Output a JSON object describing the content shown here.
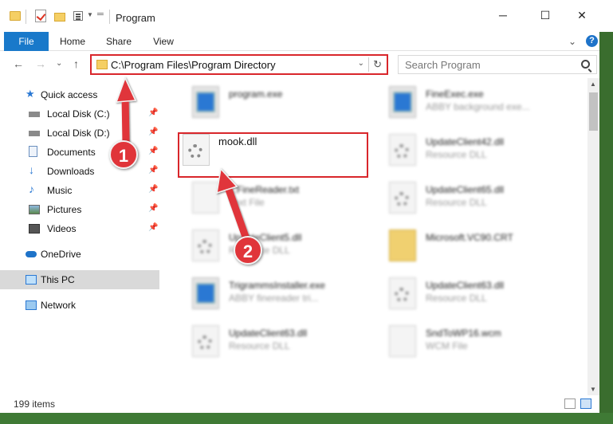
{
  "titlebar": {
    "title": "Program",
    "minimize": "─",
    "maximize": "☐",
    "close": "✕"
  },
  "ribbon": {
    "tabs": [
      "File",
      "Home",
      "Share",
      "View"
    ],
    "help": "?"
  },
  "nav": {
    "back": "←",
    "forward": "→",
    "dropdown": "⌄",
    "up": "↑",
    "address": "C:\\Program Files\\Program Directory",
    "address_dropdown": "⌄",
    "refresh": "↻",
    "search_placeholder": "Search Program"
  },
  "sidebar": {
    "quick_access": "Quick access",
    "pinned": [
      {
        "label": "Local Disk (C:)",
        "icon": "drive-icon"
      },
      {
        "label": "Local Disk (D:)",
        "icon": "drive-icon"
      },
      {
        "label": "Documents",
        "icon": "documents-icon"
      },
      {
        "label": "Downloads",
        "icon": "downloads-icon"
      },
      {
        "label": "Music",
        "icon": "music-icon"
      },
      {
        "label": "Pictures",
        "icon": "pictures-icon"
      },
      {
        "label": "Videos",
        "icon": "videos-icon"
      }
    ],
    "onedrive": "OneDrive",
    "thispc": "This PC",
    "network": "Network",
    "pin_glyph": "📌"
  },
  "files": [
    {
      "name": "program.exe",
      "sub": "",
      "type": "exe"
    },
    {
      "name": "FineExec.exe",
      "sub": "ABBY background exe...",
      "type": "exe"
    },
    {
      "name": "mook.dll",
      "sub": "",
      "type": "dll"
    },
    {
      "name": "UpdateClient42.dll",
      "sub": "Resource DLL",
      "type": "dll"
    },
    {
      "name": "...FineReader.txt",
      "sub": "Text File",
      "type": "txt"
    },
    {
      "name": "UpdateClient65.dll",
      "sub": "Resource DLL",
      "type": "dll"
    },
    {
      "name": "UpdateClient5.dll",
      "sub": "Resource DLL",
      "type": "dll"
    },
    {
      "name": "Microsoft.VC90.CRT",
      "sub": "",
      "type": "folder"
    },
    {
      "name": "TrigrammsInstaller.exe",
      "sub": "ABBY finereader tri...",
      "type": "exe"
    },
    {
      "name": "UpdateClient63.dll",
      "sub": "Resource DLL",
      "type": "dll"
    },
    {
      "name": "UpdateClient63.dll",
      "sub": "Resource DLL",
      "type": "dll"
    },
    {
      "name": "SndToWP16.wcm",
      "sub": "WCM File",
      "type": "txt"
    }
  ],
  "status": {
    "items": "199 items"
  },
  "markers": {
    "one": "1",
    "two": "2"
  },
  "colors": {
    "accent": "#1979ca",
    "highlight": "#d9262b",
    "marker": "#e0353a"
  }
}
